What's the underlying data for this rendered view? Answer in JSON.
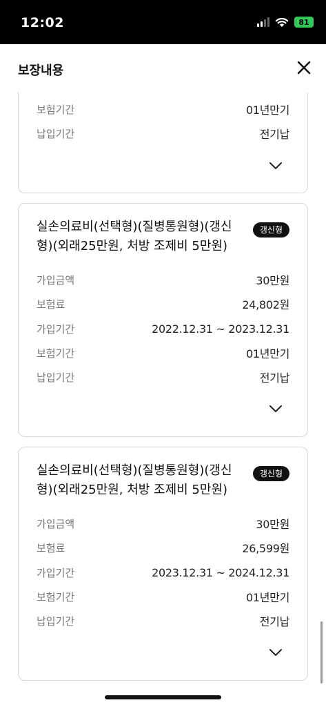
{
  "status_bar": {
    "time": "12:02",
    "battery": "81"
  },
  "header": {
    "title": "보장내용"
  },
  "cards": [
    {
      "rows": [
        {
          "label": "보험기간",
          "value": "01년만기"
        },
        {
          "label": "납입기간",
          "value": "전기납"
        }
      ]
    },
    {
      "title": "실손의료비(선택형)(질병통원형)(갱신형)(외래25만원, 처방 조제비 5만원)",
      "badge": "갱신형",
      "rows": [
        {
          "label": "가입금액",
          "value": "30만원"
        },
        {
          "label": "보험료",
          "value": "24,802원"
        },
        {
          "label": "가입기간",
          "value": "2022.12.31 ~ 2023.12.31"
        },
        {
          "label": "보험기간",
          "value": "01년만기"
        },
        {
          "label": "납입기간",
          "value": "전기납"
        }
      ]
    },
    {
      "title": "실손의료비(선택형)(질병통원형)(갱신형)(외래25만원, 처방 조제비 5만원)",
      "badge": "갱신형",
      "rows": [
        {
          "label": "가입금액",
          "value": "30만원"
        },
        {
          "label": "보험료",
          "value": "26,599원"
        },
        {
          "label": "가입기간",
          "value": "2023.12.31 ~ 2024.12.31"
        },
        {
          "label": "보험기간",
          "value": "01년만기"
        },
        {
          "label": "납입기간",
          "value": "전기납"
        }
      ]
    }
  ]
}
